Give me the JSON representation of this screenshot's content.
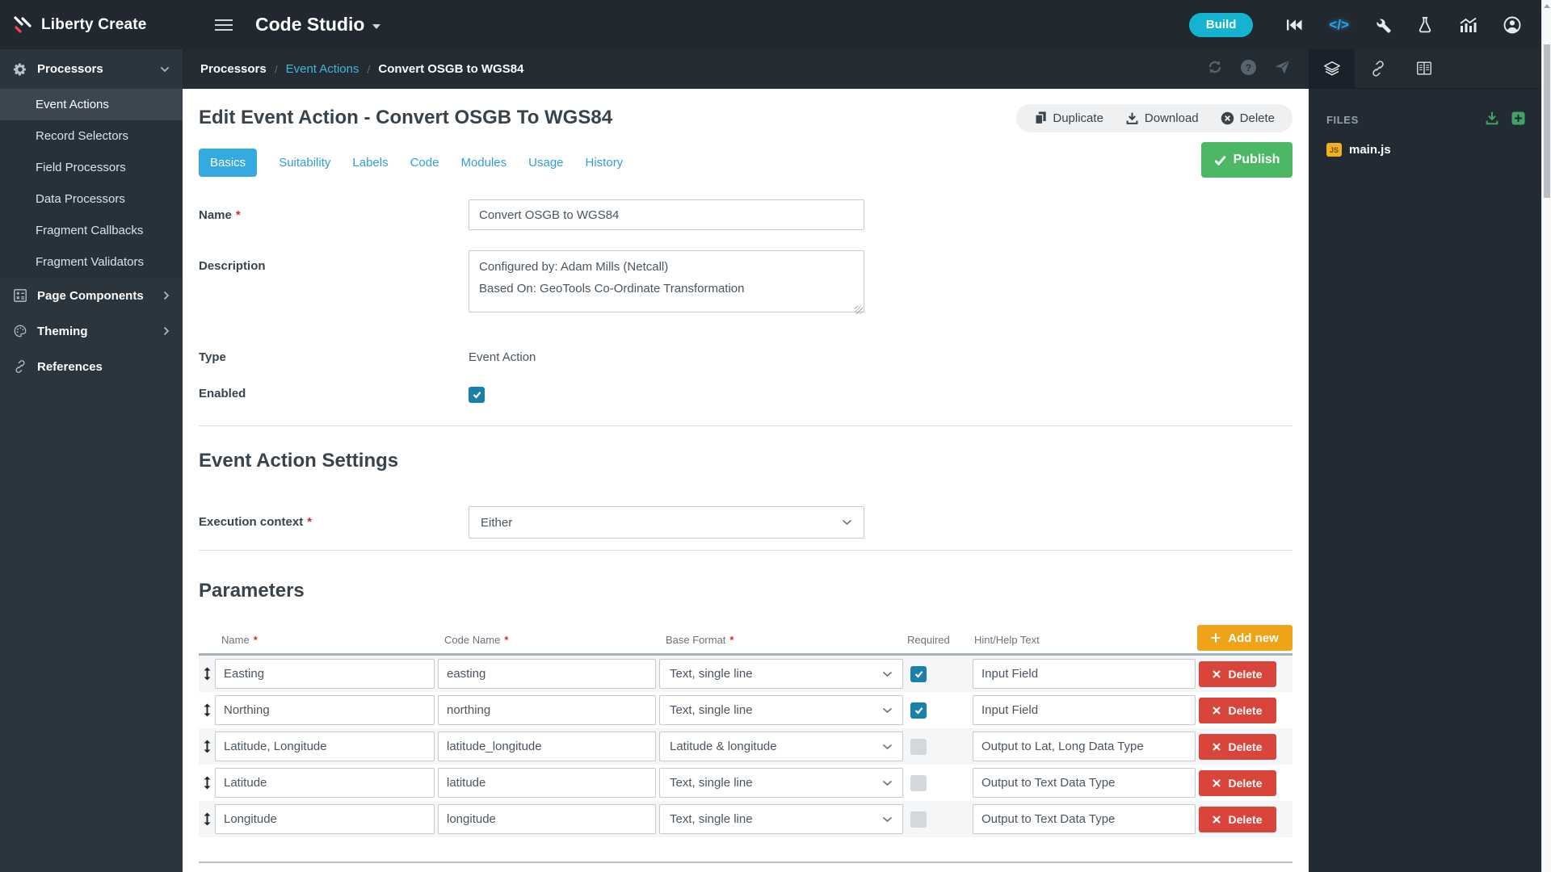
{
  "topbar": {
    "brand": "Liberty Create",
    "app_title": "Code Studio",
    "build_label": "Build"
  },
  "sidebar": {
    "processors": {
      "label": "Processors",
      "items": [
        {
          "label": "Event Actions",
          "active": true
        },
        {
          "label": "Record Selectors",
          "active": false
        },
        {
          "label": "Field Processors",
          "active": false
        },
        {
          "label": "Data Processors",
          "active": false
        },
        {
          "label": "Fragment Callbacks",
          "active": false
        },
        {
          "label": "Fragment Validators",
          "active": false
        }
      ]
    },
    "page_components": {
      "label": "Page Components"
    },
    "theming": {
      "label": "Theming"
    },
    "references": {
      "label": "References"
    }
  },
  "breadcrumb": {
    "items": [
      "Processors",
      "Event Actions",
      "Convert OSGB to WGS84"
    ]
  },
  "page": {
    "title": "Edit Event Action - Convert OSGB To WGS84",
    "actions": {
      "duplicate": "Duplicate",
      "download": "Download",
      "delete": "Delete",
      "publish": "Publish"
    },
    "tabs": [
      "Basics",
      "Suitability",
      "Labels",
      "Code",
      "Modules",
      "Usage",
      "History"
    ],
    "active_tab": "Basics"
  },
  "form": {
    "name": {
      "label": "Name",
      "value": "Convert OSGB to WGS84"
    },
    "description": {
      "label": "Description",
      "value": "Configured by: Adam Mills (Netcall)\nBased On: GeoTools Co-Ordinate Transformation"
    },
    "type": {
      "label": "Type",
      "value": "Event Action"
    },
    "enabled": {
      "label": "Enabled",
      "checked": true
    }
  },
  "settings": {
    "heading": "Event Action Settings",
    "execution_context": {
      "label": "Execution context",
      "value": "Either"
    }
  },
  "parameters": {
    "heading": "Parameters",
    "add_label": "Add new",
    "delete_label": "Delete",
    "columns": {
      "name": "Name",
      "code_name": "Code Name",
      "base_format": "Base Format",
      "required": "Required",
      "hint": "Hint/Help Text"
    },
    "rows": [
      {
        "name": "Easting",
        "code_name": "easting",
        "base_format": "Text, single line",
        "required": true,
        "hint": "Input Field"
      },
      {
        "name": "Northing",
        "code_name": "northing",
        "base_format": "Text, single line",
        "required": true,
        "hint": "Input Field"
      },
      {
        "name": "Latitude, Longitude",
        "code_name": "latitude_longitude",
        "base_format": "Latitude & longitude",
        "required": false,
        "hint": "Output to Lat, Long Data Type"
      },
      {
        "name": "Latitude",
        "code_name": "latitude",
        "base_format": "Text, single line",
        "required": false,
        "hint": "Output to Text Data Type"
      },
      {
        "name": "Longitude",
        "code_name": "longitude",
        "base_format": "Text, single line",
        "required": false,
        "hint": "Output to Text Data Type"
      }
    ]
  },
  "files_panel": {
    "heading": "FILES",
    "files": [
      {
        "name": "main.js",
        "badge": "JS"
      }
    ]
  },
  "ui": {
    "required_mark": "*",
    "breadcrumb_sep": "/",
    "code_glyph": "</>"
  },
  "colors": {
    "build_cyan": "#14b4d1",
    "active_tab_blue": "#35aade",
    "link_blue": "#2f9fd6",
    "breadcrumb_link": "#43b6d2",
    "publish_green": "#4cb865",
    "add_new_orange": "#efa318",
    "delete_red": "#d9453a",
    "checkbox_teal": "#1a80a9",
    "js_badge_yellow": "#f2b01e",
    "panel_green_icons": "#3fa465",
    "topbar_bg": "#21282f",
    "sidebar_bg": "#2b353e"
  }
}
